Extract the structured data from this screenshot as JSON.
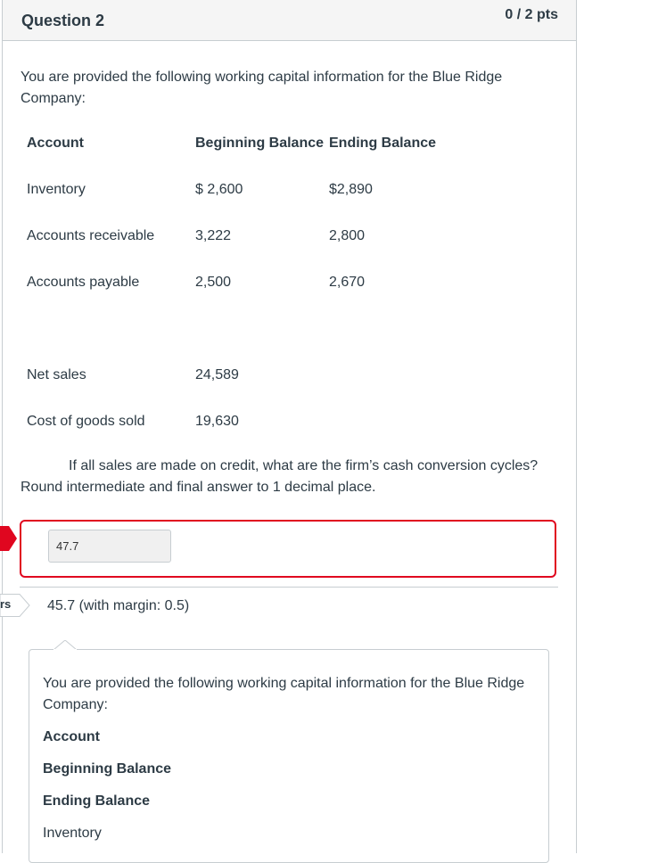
{
  "question": {
    "title": "Question 2",
    "points": "0 / 2 pts"
  },
  "intro": {
    "line1": "You are provided the following working capital information for the Blue Ridge",
    "line2": "Company:"
  },
  "table": {
    "headers": [
      "Account",
      "Beginning Balance",
      "Ending Balance"
    ],
    "rows": [
      {
        "account": "Inventory",
        "beginning": "$ 2,600",
        "ending": "$2,890"
      },
      {
        "account": "Accounts receivable",
        "beginning": "3,222",
        "ending": "2,800"
      },
      {
        "account": "Accounts payable",
        "beginning": "2,500",
        "ending": "2,670"
      },
      {
        "account": "Net sales",
        "beginning": "24,589",
        "ending": ""
      },
      {
        "account": "Cost of goods sold",
        "beginning": "19,630",
        "ending": ""
      }
    ]
  },
  "prompt": {
    "line1": "If all sales are made on credit, what are the firm’s cash conversion cycles?",
    "line2": "Round intermediate and final answer to 1 decimal place."
  },
  "answer": {
    "value": "47.7"
  },
  "correct_answer": {
    "tag": "rs",
    "text": "45.7 (with margin: 0.5)"
  },
  "feedback": {
    "line1": "You are provided the following working capital information for the Blue Ridge",
    "line2": "Company:",
    "account": "Account",
    "beginning": "Beginning Balance",
    "ending": "Ending Balance",
    "inventory": "Inventory"
  },
  "colors": {
    "incorrect": "#e0061f",
    "border": "#c7cdd1",
    "text": "#2d3b45"
  }
}
